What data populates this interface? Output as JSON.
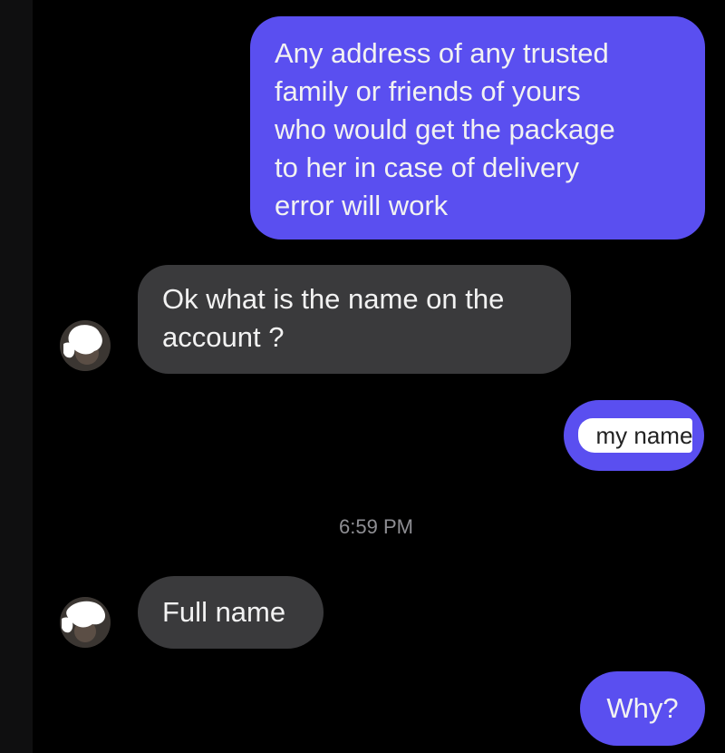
{
  "conversation": {
    "messages": [
      {
        "direction": "outgoing",
        "lines": [
          "Any address of any trusted",
          "family or friends of yours",
          "who would get the package",
          "to her in case of delivery",
          "error will work"
        ]
      },
      {
        "direction": "incoming",
        "lines": [
          "Ok what is the name on the",
          "account ?"
        ]
      },
      {
        "direction": "outgoing",
        "text": "my name"
      },
      {
        "direction": "incoming",
        "text": "Full name"
      },
      {
        "direction": "outgoing",
        "text": "Why?"
      }
    ],
    "timestamp": "6:59 PM"
  },
  "colors": {
    "background": "#000000",
    "outgoing_bubble": "#5a4ff0",
    "incoming_bubble": "#3a3a3c",
    "bubble_text": "#f2f2f2",
    "timestamp_text": "#8e8e93",
    "redaction": "#ffffff"
  },
  "icons": {
    "contact_avatar": "redacted-avatar-icon"
  }
}
